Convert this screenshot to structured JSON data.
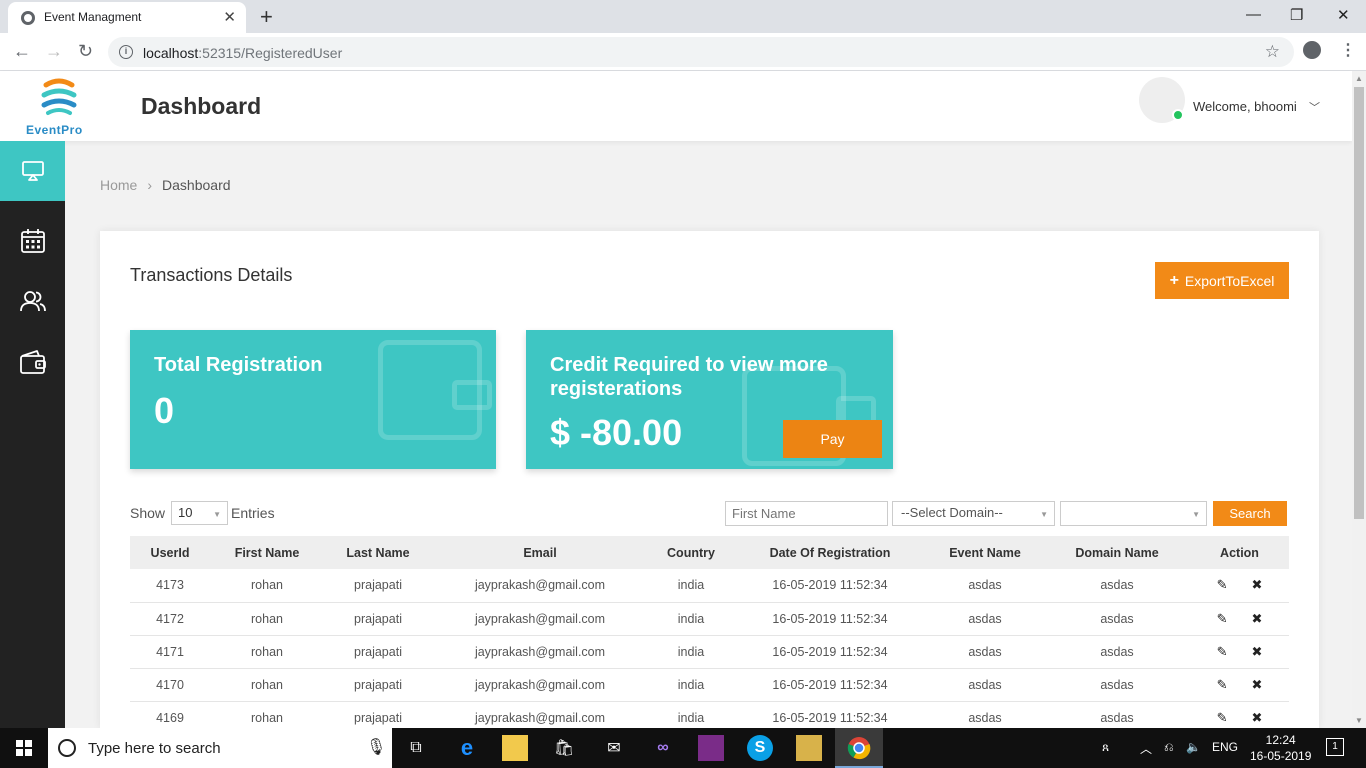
{
  "browser": {
    "tab_title": "Event Managment",
    "url_host": "localhost",
    "url_rest": ":52315/RegisteredUser"
  },
  "app": {
    "logo_text": "EventPro",
    "page_title": "Dashboard",
    "welcome": "Welcome, bhoomi",
    "accent_color": "#3ec6c3",
    "orange_color": "#f28a17"
  },
  "sidebar": {
    "items": [
      {
        "icon": "monitor-icon",
        "active": true
      },
      {
        "icon": "calendar-icon",
        "active": false
      },
      {
        "icon": "users-icon",
        "active": false
      },
      {
        "icon": "wallet-icon",
        "active": false
      }
    ]
  },
  "breadcrumb": {
    "home": "Home",
    "current": "Dashboard"
  },
  "panel": {
    "title": "Transactions Details",
    "export_label": "ExportToExcel"
  },
  "cards": {
    "total": {
      "label": "Total Registration",
      "value": "0"
    },
    "credit": {
      "label_line1": "Credit Required to view more",
      "label_line2": "registerations",
      "value": "$ -80.00",
      "pay_label": "Pay"
    }
  },
  "filters": {
    "show_label": "Show",
    "entries_value": "10",
    "entries_label": "Entries",
    "first_name_placeholder": "First Name",
    "domain_select": "--Select Domain--",
    "event_select": "",
    "search_label": "Search"
  },
  "table": {
    "headers": [
      "UserId",
      "First Name",
      "Last Name",
      "Email",
      "Country",
      "Date Of Registration",
      "Event Name",
      "Domain Name",
      "Action"
    ],
    "rows": [
      [
        "4173",
        "rohan",
        "prajapati",
        "jayprakash@gmail.com",
        "india",
        "16-05-2019 11:52:34",
        "asdas",
        "asdas"
      ],
      [
        "4172",
        "rohan",
        "prajapati",
        "jayprakash@gmail.com",
        "india",
        "16-05-2019 11:52:34",
        "asdas",
        "asdas"
      ],
      [
        "4171",
        "rohan",
        "prajapati",
        "jayprakash@gmail.com",
        "india",
        "16-05-2019 11:52:34",
        "asdas",
        "asdas"
      ],
      [
        "4170",
        "rohan",
        "prajapati",
        "jayprakash@gmail.com",
        "india",
        "16-05-2019 11:52:34",
        "asdas",
        "asdas"
      ],
      [
        "4169",
        "rohan",
        "prajapati",
        "jayprakash@gmail.com",
        "india",
        "16-05-2019 11:52:34",
        "asdas",
        "asdas"
      ]
    ]
  },
  "taskbar": {
    "search_placeholder": "Type here to search",
    "lang": "ENG",
    "time": "12:24",
    "date": "16-05-2019",
    "notifications": "1"
  }
}
